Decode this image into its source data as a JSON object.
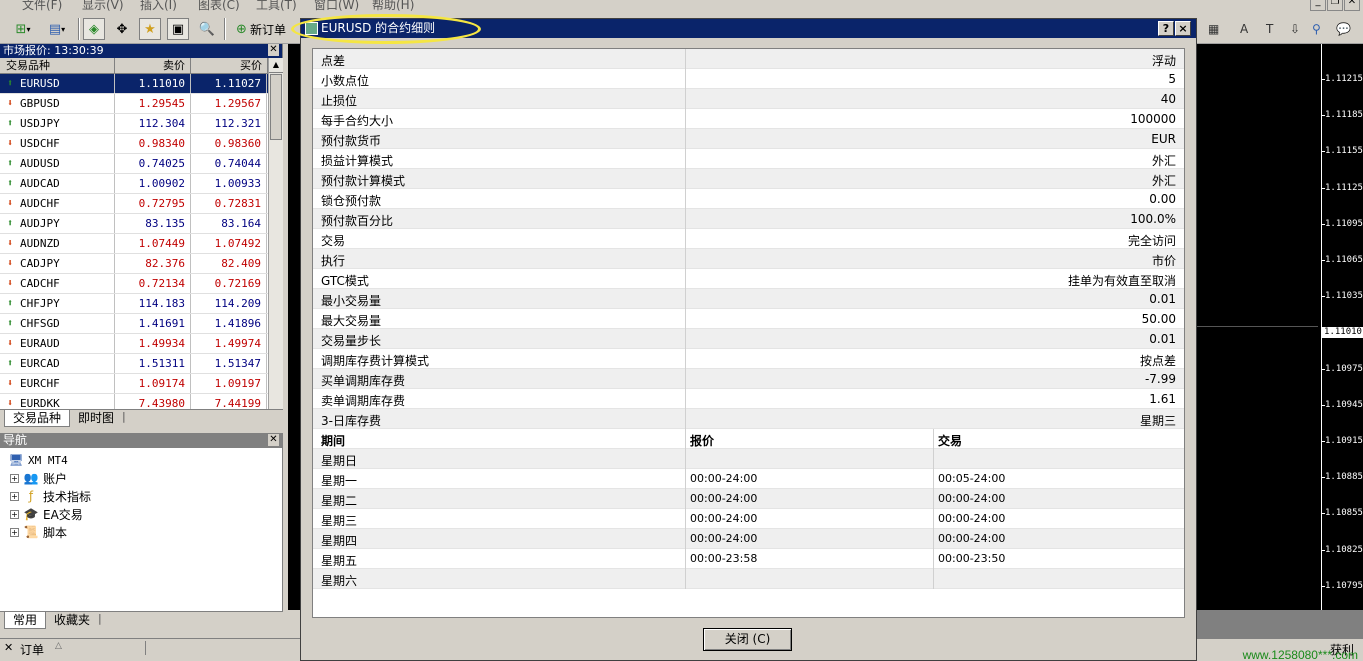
{
  "menu": {
    "items": [
      "文件(F)",
      "显示(V)",
      "插入(I)",
      "图表(C)",
      "工具(T)",
      "窗口(W)",
      "帮助(H)"
    ]
  },
  "toolbar": {
    "new_order_label": "新订单"
  },
  "market_watch": {
    "title": "市场报价: 13:30:39",
    "col_symbol": "交易品种",
    "col_bid": "卖价",
    "col_ask": "买价",
    "rows": [
      {
        "symbol": "EURUSD",
        "bid": "1.11010",
        "ask": "1.11027",
        "dir": "up",
        "selected": true
      },
      {
        "symbol": "GBPUSD",
        "bid": "1.29545",
        "ask": "1.29567",
        "dir": "down"
      },
      {
        "symbol": "USDJPY",
        "bid": "112.304",
        "ask": "112.321",
        "dir": "up"
      },
      {
        "symbol": "USDCHF",
        "bid": "0.98340",
        "ask": "0.98360",
        "dir": "down"
      },
      {
        "symbol": "AUDUSD",
        "bid": "0.74025",
        "ask": "0.74044",
        "dir": "up"
      },
      {
        "symbol": "AUDCAD",
        "bid": "1.00902",
        "ask": "1.00933",
        "dir": "up"
      },
      {
        "symbol": "AUDCHF",
        "bid": "0.72795",
        "ask": "0.72831",
        "dir": "down"
      },
      {
        "symbol": "AUDJPY",
        "bid": "83.135",
        "ask": "83.164",
        "dir": "up"
      },
      {
        "symbol": "AUDNZD",
        "bid": "1.07449",
        "ask": "1.07492",
        "dir": "down"
      },
      {
        "symbol": "CADJPY",
        "bid": "82.376",
        "ask": "82.409",
        "dir": "down"
      },
      {
        "symbol": "CADCHF",
        "bid": "0.72134",
        "ask": "0.72169",
        "dir": "down"
      },
      {
        "symbol": "CHFJPY",
        "bid": "114.183",
        "ask": "114.209",
        "dir": "up"
      },
      {
        "symbol": "CHFSGD",
        "bid": "1.41691",
        "ask": "1.41896",
        "dir": "up"
      },
      {
        "symbol": "EURAUD",
        "bid": "1.49934",
        "ask": "1.49974",
        "dir": "down"
      },
      {
        "symbol": "EURCAD",
        "bid": "1.51311",
        "ask": "1.51347",
        "dir": "up"
      },
      {
        "symbol": "EURCHF",
        "bid": "1.09174",
        "ask": "1.09197",
        "dir": "down"
      },
      {
        "symbol": "EURDKK",
        "bid": "7.43980",
        "ask": "7.44199",
        "dir": "down"
      }
    ],
    "tabs": [
      "交易品种",
      "即时图"
    ]
  },
  "navigator": {
    "title": "导航",
    "root": "XM MT4",
    "items": [
      "账户",
      "技术指标",
      "EA交易",
      "脚本"
    ],
    "tabs": [
      "常用",
      "收藏夹"
    ]
  },
  "dialog": {
    "title": "EURUSD 的合约细则",
    "help_btn": "?",
    "close_x": "×",
    "specs": [
      {
        "label": "点差",
        "value": "浮动"
      },
      {
        "label": "小数点位",
        "value": "5"
      },
      {
        "label": "止损位",
        "value": "40"
      },
      {
        "label": "每手合约大小",
        "value": "100000"
      },
      {
        "label": "预付款货币",
        "value": "EUR"
      },
      {
        "label": "损益计算模式",
        "value": "外汇"
      },
      {
        "label": "预付款计算模式",
        "value": "外汇"
      },
      {
        "label": "锁仓预付款",
        "value": "0.00"
      },
      {
        "label": "预付款百分比",
        "value": "100.0%"
      },
      {
        "label": "交易",
        "value": "完全访问"
      },
      {
        "label": "执行",
        "value": "市价"
      },
      {
        "label": "GTC模式",
        "value": "挂单为有效直至取消"
      },
      {
        "label": "最小交易量",
        "value": "0.01"
      },
      {
        "label": "最大交易量",
        "value": "50.00"
      },
      {
        "label": "交易量步长",
        "value": "0.01"
      },
      {
        "label": "调期库存费计算模式",
        "value": "按点差"
      },
      {
        "label": "买单调期库存费",
        "value": "-7.99"
      },
      {
        "label": "卖单调期库存费",
        "value": "1.61"
      },
      {
        "label": "3-日库存费",
        "value": "星期三"
      }
    ],
    "sessions_header": {
      "period": "期间",
      "quote": "报价",
      "trade": "交易"
    },
    "sessions": [
      {
        "day": "星期日",
        "quote": "",
        "trade": ""
      },
      {
        "day": "星期一",
        "quote": "00:00-24:00",
        "trade": "00:05-24:00"
      },
      {
        "day": "星期二",
        "quote": "00:00-24:00",
        "trade": "00:00-24:00"
      },
      {
        "day": "星期三",
        "quote": "00:00-24:00",
        "trade": "00:00-24:00"
      },
      {
        "day": "星期四",
        "quote": "00:00-24:00",
        "trade": "00:00-24:00"
      },
      {
        "day": "星期五",
        "quote": "00:00-23:58",
        "trade": "00:00-23:50"
      },
      {
        "day": "星期六",
        "quote": "",
        "trade": ""
      }
    ],
    "close_button": "关闭 (C)"
  },
  "chart": {
    "price_labels": [
      "1.11215",
      "1.11185",
      "1.11155",
      "1.11125",
      "1.11095",
      "1.11065",
      "1.11035",
      "1.11010",
      "1.10975",
      "1.10945",
      "1.10915",
      "1.10885",
      "1.10855",
      "1.10825",
      "1.10795"
    ],
    "current_price": "1.11010"
  },
  "bottom": {
    "orders_label": "订单",
    "profit_label": "获利",
    "watermark": "www.1258080***.com"
  },
  "colors": {
    "title_active": "#0a246a",
    "price_up": "#000080",
    "price_down": "#c00000",
    "arrow_up": "#2a8a2a",
    "arrow_down": "#d04010",
    "highlight": "#f5e642"
  }
}
